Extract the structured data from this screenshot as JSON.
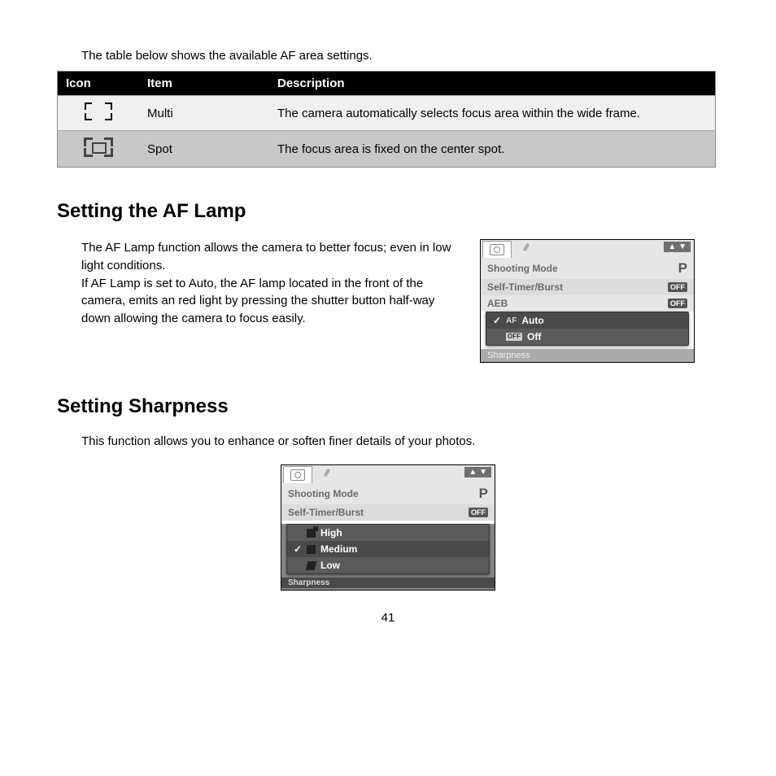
{
  "intro": "The table below shows the available AF area settings.",
  "table": {
    "headers": {
      "icon": "Icon",
      "item": "Item",
      "description": "Description"
    },
    "rows": [
      {
        "item": "Multi",
        "description": "The camera automatically selects focus area within the wide frame."
      },
      {
        "item": "Spot",
        "description": "The focus area is fixed on the center spot."
      }
    ]
  },
  "aflamp": {
    "heading": "Setting the AF Lamp",
    "text": "The AF Lamp function allows the camera to better focus; even in low light conditions.\nIf AF Lamp is set to Auto, the AF lamp located in the front of the camera, emits an red light by pressing the shutter button half-way down allowing the camera to focus easily.",
    "lcd": {
      "scroll": "▲ ▼",
      "rows": {
        "shooting_mode": "Shooting Mode",
        "shooting_val": "P",
        "self_timer": "Self-Timer/Burst",
        "off1": "OFF",
        "aeb": "AEB",
        "off2": "OFF"
      },
      "popup": {
        "opt1_pre": "AF",
        "opt1": "Auto",
        "opt2_badge": "OFF",
        "opt2": "Off"
      },
      "cut": "Sharpness"
    }
  },
  "sharpness": {
    "heading": "Setting Sharpness",
    "intro": "This function allows you to enhance or soften finer details of your photos.",
    "lcd": {
      "scroll": "▲ ▼",
      "rows": {
        "shooting_mode": "Shooting Mode",
        "shooting_val": "P",
        "self_timer": "Self-Timer/Burst",
        "off1": "OFF"
      },
      "popup": {
        "opt1": "High",
        "opt2": "Medium",
        "opt3": "Low"
      },
      "cut": "Sharpness"
    }
  },
  "page": "41"
}
